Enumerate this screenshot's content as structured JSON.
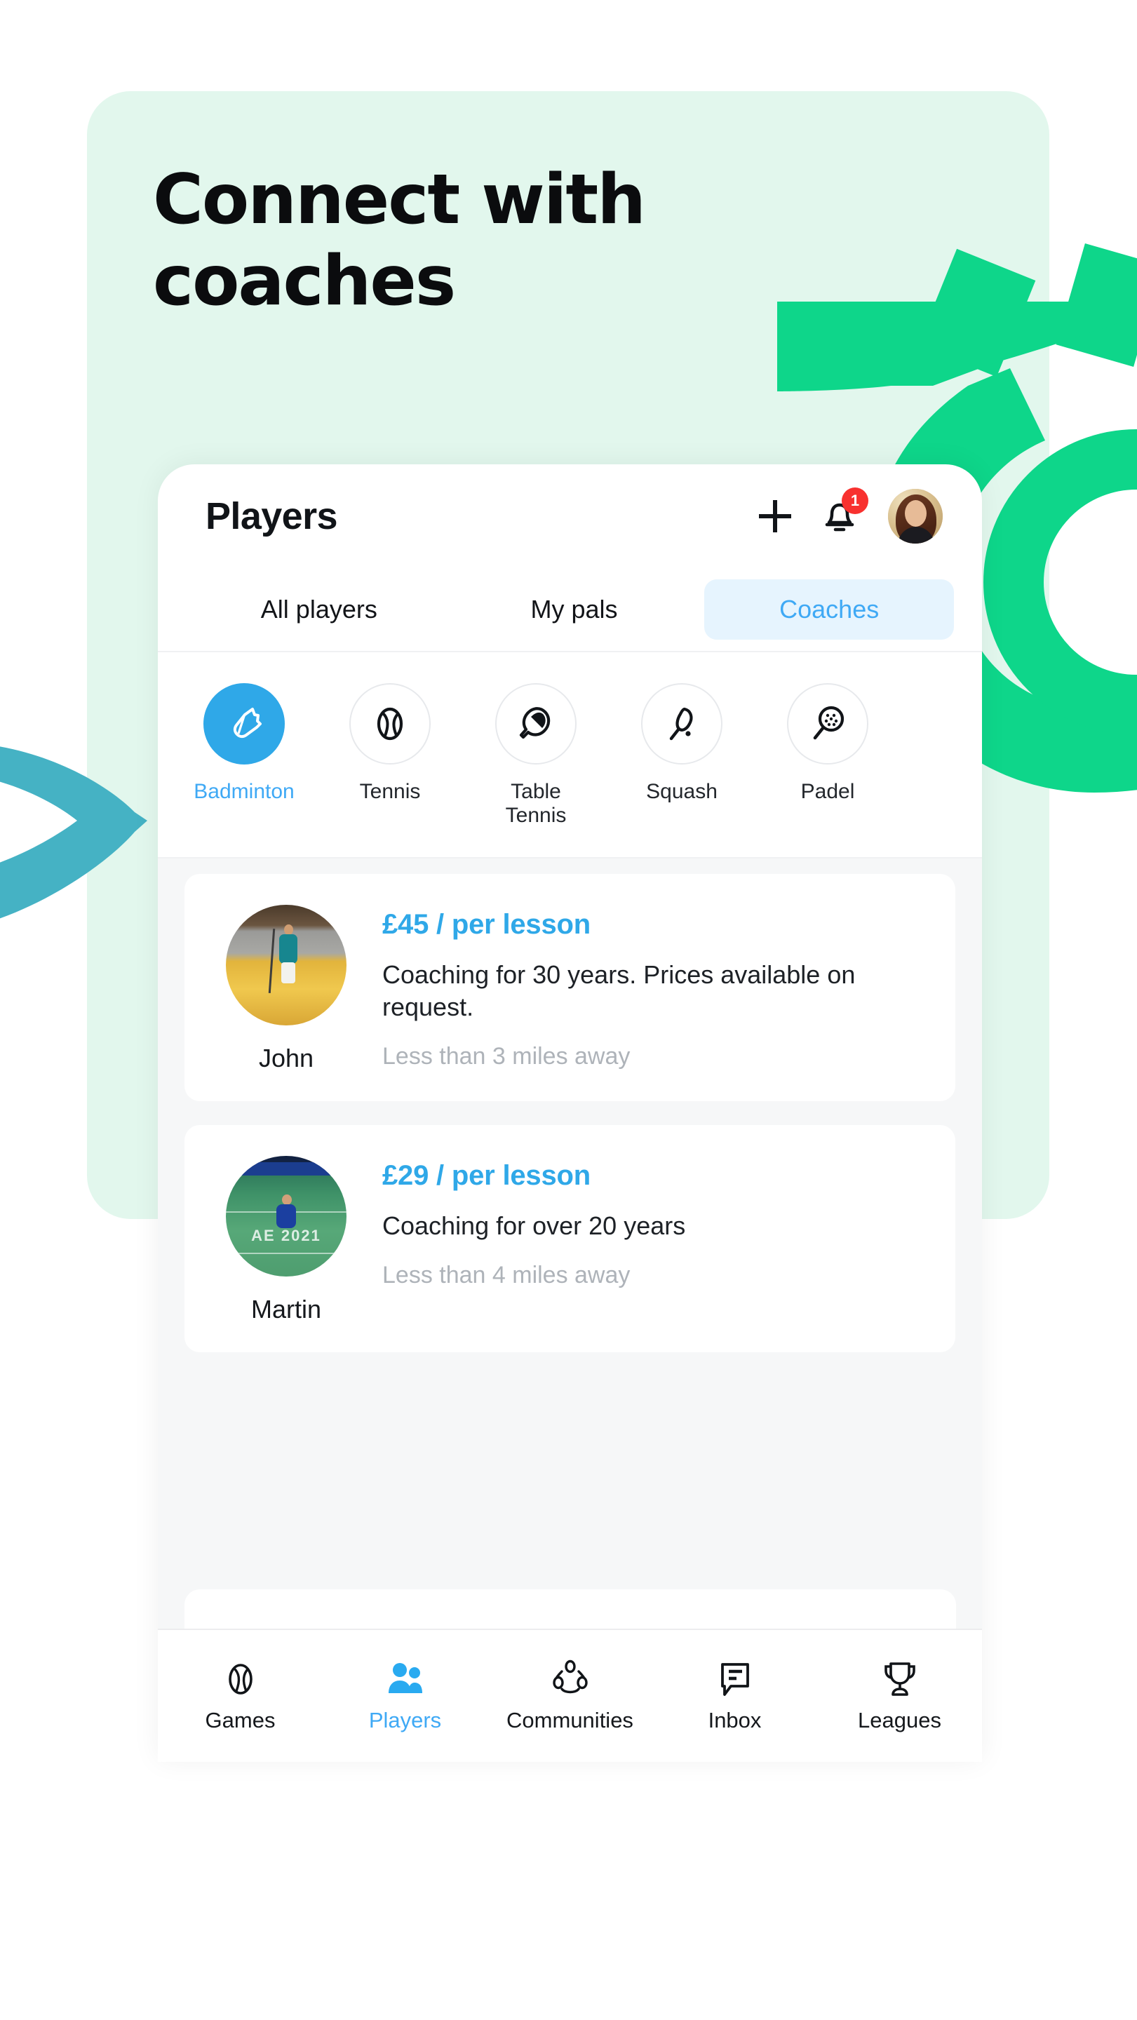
{
  "marketing": {
    "headline_line1": "Connect with",
    "headline_line2": "coaches",
    "panel_color": "#e2f7ed",
    "accent_green": "#0ed68a",
    "accent_teal": "#45b2c4"
  },
  "app": {
    "header": {
      "title": "Players",
      "add_icon": "plus-icon",
      "notifications_icon": "bell-icon",
      "notification_count": "1",
      "notification_badge_color": "#f8312f",
      "avatar": "user-avatar"
    },
    "tabs": [
      {
        "label": "All players",
        "active": false
      },
      {
        "label": "My pals",
        "active": false
      },
      {
        "label": "Coaches",
        "active": true
      }
    ],
    "tab_active_color": "#3fa9f5",
    "tab_active_bg": "#e6f4fe",
    "sports": [
      {
        "label": "Badminton",
        "icon": "shuttlecock-icon",
        "active": true
      },
      {
        "label": "Tennis",
        "icon": "tennis-ball-icon",
        "active": false
      },
      {
        "label": "Table Tennis",
        "icon": "table-tennis-paddle-icon",
        "active": false
      },
      {
        "label": "Squash",
        "icon": "squash-racket-icon",
        "active": false
      },
      {
        "label": "Padel",
        "icon": "padel-racket-icon",
        "active": false
      }
    ],
    "coaches": [
      {
        "name": "John",
        "price": "£45 / per lesson",
        "description": "Coaching for 30 years. Prices available on request.",
        "distance": "Less than 3 miles away",
        "photo": "john-badminton-court-photo"
      },
      {
        "name": "Martin",
        "price": "£29 / per lesson",
        "description": "Coaching for over 20 years",
        "distance": "Less than 4 miles away",
        "photo": "martin-badminton-court-photo",
        "photo_overlay_text": "AE 2021"
      }
    ],
    "price_color": "#2fa8e8",
    "distance_color": "#aeb3b9",
    "bottom_nav": [
      {
        "label": "Games",
        "icon": "ball-icon",
        "active": false
      },
      {
        "label": "Players",
        "icon": "people-icon",
        "active": true
      },
      {
        "label": "Communities",
        "icon": "communities-icon",
        "active": false
      },
      {
        "label": "Inbox",
        "icon": "chat-bubble-icon",
        "active": false
      },
      {
        "label": "Leagues",
        "icon": "trophy-icon",
        "active": false
      }
    ]
  }
}
